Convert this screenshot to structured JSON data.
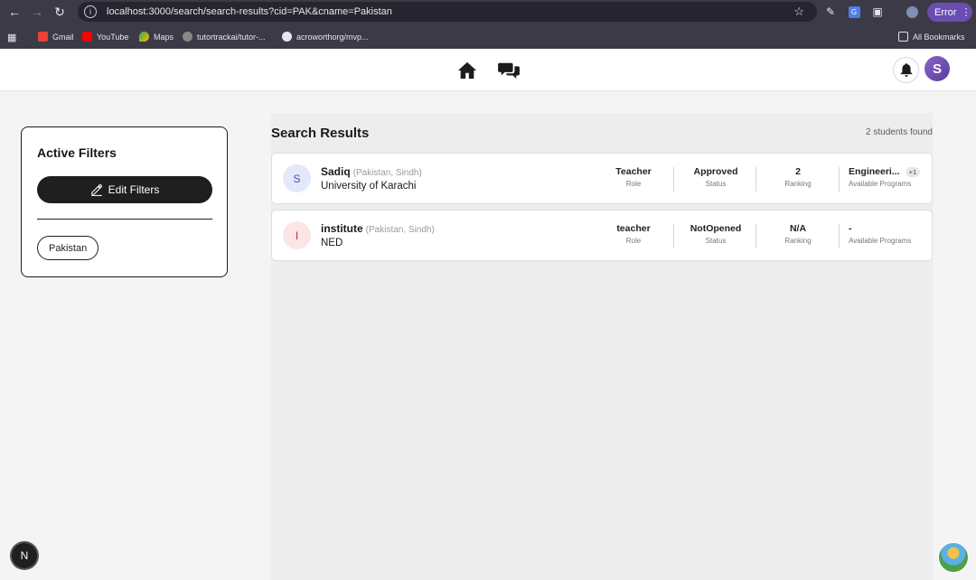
{
  "browser": {
    "url": "localhost:3000/search/search-results?cid=PAK&cname=Pakistan",
    "profile_status": "Error",
    "bookmarks": [
      "Gmail",
      "YouTube",
      "Maps",
      "tutortrackai/tutor-...",
      "acroworthorg/mvp..."
    ],
    "all_bookmarks": "All Bookmarks"
  },
  "header": {
    "avatar_letter": "S"
  },
  "filters": {
    "title": "Active Filters",
    "edit_label": "Edit Filters",
    "chips": [
      "Pakistan"
    ]
  },
  "results": {
    "title": "Search Results",
    "count_text": "2 students found",
    "items": [
      {
        "initial": "S",
        "name": "Sadiq",
        "location": "(Pakistan, Sindh)",
        "institution": "University of Karachi",
        "role": "Teacher",
        "role_label": "Role",
        "status": "Approved",
        "status_label": "Status",
        "ranking": "2",
        "ranking_label": "Ranking",
        "programs": "Engineeri...",
        "programs_extra": "+1",
        "programs_label": "Available Programs"
      },
      {
        "initial": "I",
        "name": "institute",
        "location": "(Pakistan, Sindh)",
        "institution": "NED",
        "role": "teacher",
        "role_label": "Role",
        "status": "NotOpened",
        "status_label": "Status",
        "ranking": "N/A",
        "ranking_label": "Ranking",
        "programs": "-",
        "programs_label": "Available Programs"
      }
    ]
  },
  "dev_badge": "N",
  "colors": {
    "accent_purple": "#6a4db0",
    "avatar_s_bg": "#e4e9f9",
    "avatar_s_fg": "#3b55b5",
    "avatar_i_bg": "#fde5e5",
    "avatar_i_fg": "#c62f2f"
  }
}
